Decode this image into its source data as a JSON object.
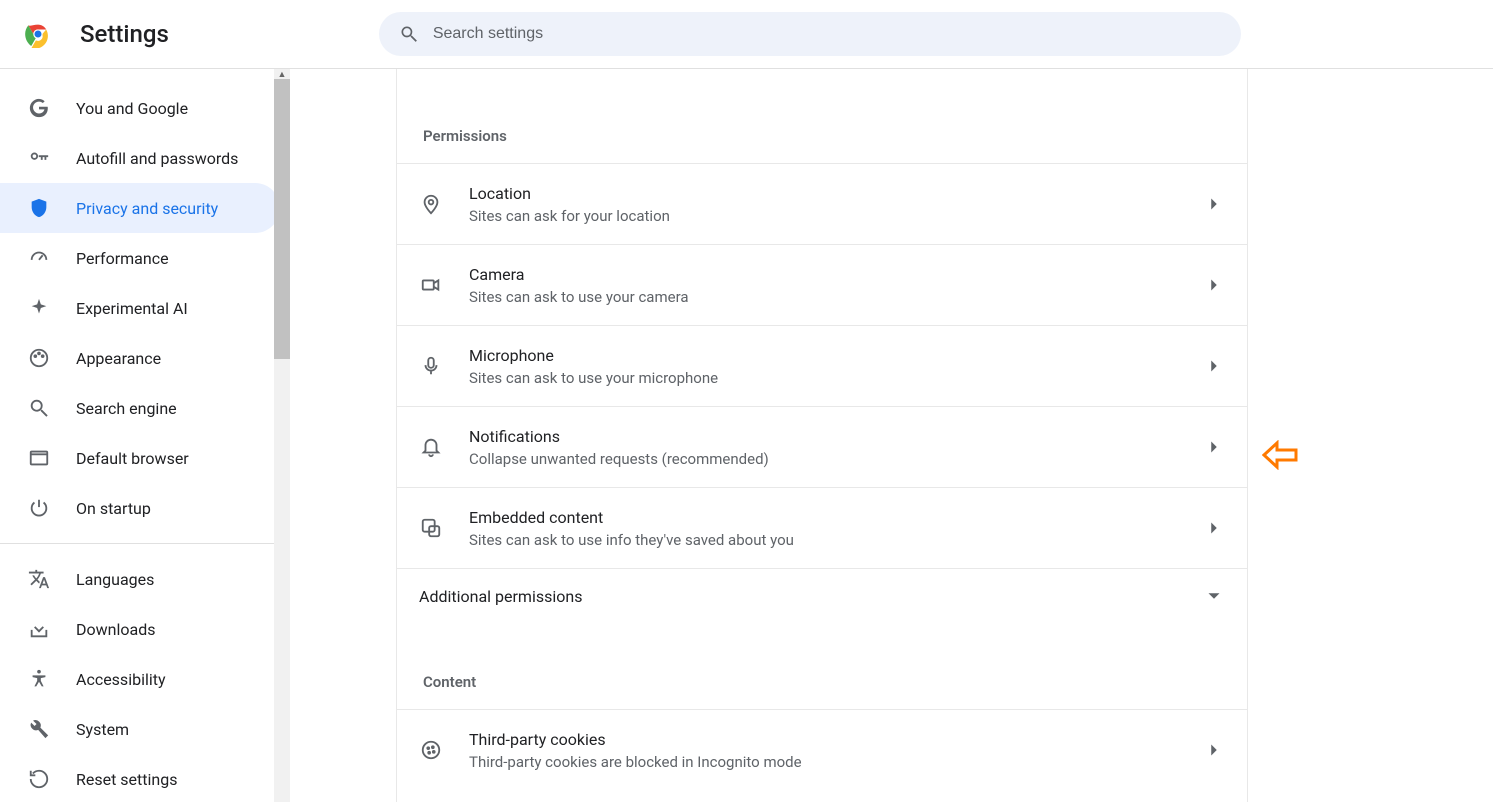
{
  "header": {
    "title": "Settings",
    "search_placeholder": "Search settings"
  },
  "sidebar": {
    "items": [
      {
        "label": "You and Google",
        "icon": "google"
      },
      {
        "label": "Autofill and passwords",
        "icon": "key"
      },
      {
        "label": "Privacy and security",
        "icon": "shield",
        "active": true
      },
      {
        "label": "Performance",
        "icon": "speed"
      },
      {
        "label": "Experimental AI",
        "icon": "sparkle"
      },
      {
        "label": "Appearance",
        "icon": "palette"
      },
      {
        "label": "Search engine",
        "icon": "search"
      },
      {
        "label": "Default browser",
        "icon": "window"
      },
      {
        "label": "On startup",
        "icon": "power"
      }
    ],
    "items2": [
      {
        "label": "Languages",
        "icon": "translate"
      },
      {
        "label": "Downloads",
        "icon": "download"
      },
      {
        "label": "Accessibility",
        "icon": "accessibility"
      },
      {
        "label": "System",
        "icon": "wrench"
      },
      {
        "label": "Reset settings",
        "icon": "reset"
      }
    ]
  },
  "main": {
    "permissions_title": "Permissions",
    "permissions": [
      {
        "title": "Location",
        "sub": "Sites can ask for your location",
        "icon": "location"
      },
      {
        "title": "Camera",
        "sub": "Sites can ask to use your camera",
        "icon": "camera"
      },
      {
        "title": "Microphone",
        "sub": "Sites can ask to use your microphone",
        "icon": "mic"
      },
      {
        "title": "Notifications",
        "sub": "Collapse unwanted requests (recommended)",
        "icon": "bell"
      },
      {
        "title": "Embedded content",
        "sub": "Sites can ask to use info they've saved about you",
        "icon": "embed"
      }
    ],
    "additional_permissions": "Additional permissions",
    "content_title": "Content",
    "content_rows": [
      {
        "title": "Third-party cookies",
        "sub": "Third-party cookies are blocked in Incognito mode",
        "icon": "cookie"
      }
    ]
  }
}
